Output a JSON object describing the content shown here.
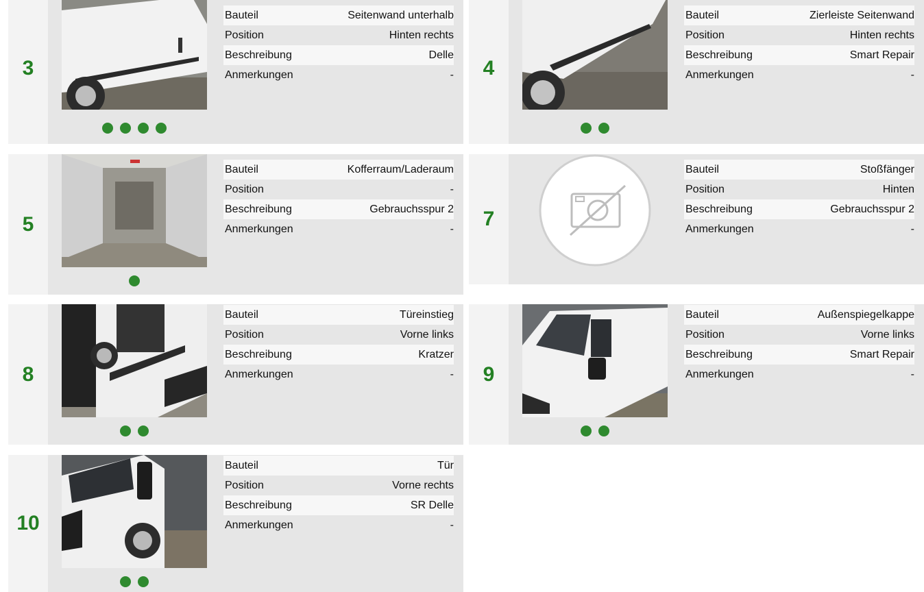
{
  "labels": {
    "bauteil": "Bauteil",
    "position": "Position",
    "beschreibung": "Beschreibung",
    "anmerkungen": "Anmerkungen"
  },
  "damages": [
    {
      "number": "3",
      "bauteil": "Seitenwand unterhalb",
      "position": "Hinten rechts",
      "beschreibung": "Delle",
      "anmerkungen": "-",
      "photos": 4
    },
    {
      "number": "4",
      "bauteil": "Zierleiste Seitenwand",
      "position": "Hinten rechts",
      "beschreibung": "Smart Repair",
      "anmerkungen": "-",
      "photos": 2
    },
    {
      "number": "5",
      "bauteil": "Kofferraum/Laderaum",
      "position": "-",
      "beschreibung": "Gebrauchsspur 2",
      "anmerkungen": "-",
      "photos": 1
    },
    {
      "number": "7",
      "bauteil": "Stoßfänger",
      "position": "Hinten",
      "beschreibung": "Gebrauchsspur 2",
      "anmerkungen": "-",
      "photos": 0
    },
    {
      "number": "8",
      "bauteil": "Türeinstieg",
      "position": "Vorne links",
      "beschreibung": "Kratzer",
      "anmerkungen": "-",
      "photos": 2
    },
    {
      "number": "9",
      "bauteil": "Außenspiegelkappe",
      "position": "Vorne links",
      "beschreibung": "Smart Repair",
      "anmerkungen": "-",
      "photos": 2
    },
    {
      "number": "10",
      "bauteil": "Tür",
      "position": "Vorne rechts",
      "beschreibung": "SR Delle",
      "anmerkungen": "-",
      "photos": 2
    }
  ],
  "colors": {
    "accent": "#238023",
    "dot": "#2f8a2f",
    "card": "#e6e6e6"
  }
}
